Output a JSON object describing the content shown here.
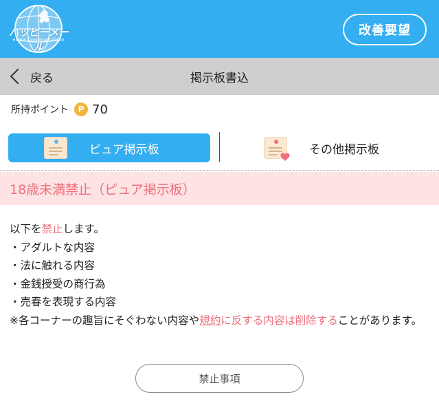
{
  "header": {
    "logo_text": "ハッピーメール",
    "logo_sub": "HAPPY COMMUNICATION",
    "kaizen_label": "改善要望"
  },
  "nav": {
    "back_label": "戻る",
    "title": "掲示板書込"
  },
  "points": {
    "label": "所持ポイント",
    "coin_symbol": "P",
    "value": "70"
  },
  "tabs": {
    "pure": {
      "label": "ピュア掲示板"
    },
    "other": {
      "label": "その他掲示板"
    }
  },
  "warning": {
    "text": "18歳未満禁止（ピュア掲示板）"
  },
  "content": {
    "intro_prefix": "以下を",
    "intro_highlight": "禁止",
    "intro_suffix": "します。",
    "items": [
      "・アダルトな内容",
      "・法に触れる内容",
      "・金銭授受の商行為",
      "・売春を表現する内容"
    ],
    "note_prefix": "※各コーナーの趣旨にそぐわない内容や",
    "note_link": "規約",
    "note_highlight": "に反する内容は削除する",
    "note_suffix": "ことがあります。"
  },
  "buttons": {
    "rules_label": "禁止事項"
  },
  "colors": {
    "accent": "#33aef0",
    "warning_bg": "#fde3e3",
    "warning_text": "#ef6f7d",
    "coin": "#f2b53a"
  }
}
